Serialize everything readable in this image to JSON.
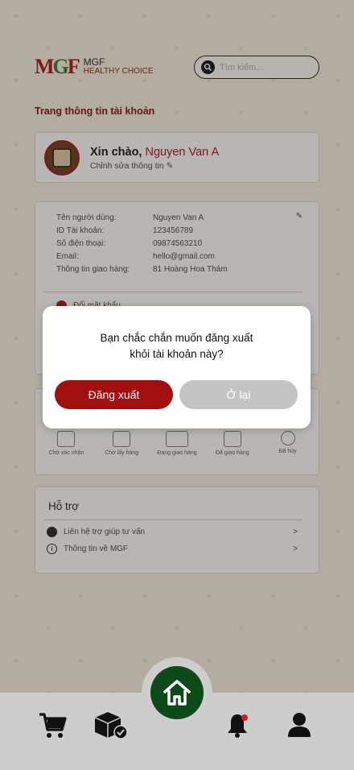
{
  "header": {
    "logo_mark_1": "M",
    "logo_mark_2": "G",
    "logo_mark_3": "F",
    "logo_line1": "MGF",
    "logo_line2": "HEALTHY CHOICE",
    "search_placeholder": "Tìm kiếm..."
  },
  "page_title": "Trang thông tin tài khoản",
  "profile": {
    "greeting": "Xin chào,",
    "name": "Nguyen Van A",
    "edit_label": "Chỉnh sửa thông tin"
  },
  "info": {
    "rows": [
      {
        "key": "Tên người dùng:",
        "value": "Nguyen Van A"
      },
      {
        "key": "ID Tài khoản:",
        "value": "123456789"
      },
      {
        "key": "Số điện thoại:",
        "value": "09874563210"
      },
      {
        "key": "Email:",
        "value": "hello@gmail.com"
      },
      {
        "key": "Thông tin giao hàng:",
        "value": "81 Hoàng Hoa Thám"
      }
    ],
    "change_password": "Đổi mật khẩu"
  },
  "orders": {
    "items": [
      {
        "label": "Chờ xác nhận",
        "icon": "box-open-icon"
      },
      {
        "label": "Chờ lấy hàng",
        "icon": "box-icon"
      },
      {
        "label": "Đang giao hàng",
        "icon": "truck-icon"
      },
      {
        "label": "Đã giao hàng",
        "icon": "box-check-icon"
      },
      {
        "label": "Đã hủy",
        "icon": "cancel-icon"
      }
    ]
  },
  "support": {
    "title": "Hỗ trợ",
    "items": [
      {
        "label": "Liên hệ trợ giúp tư vấn",
        "chevron": ">"
      },
      {
        "label": "Thông tin về MGF",
        "chevron": ">"
      }
    ]
  },
  "dialog": {
    "line1": "Bạn chắc chắn muốn đăng xuất",
    "line2": "khỏi tài khoản này?",
    "confirm_label": "Đăng xuất",
    "cancel_label": "Ở lại"
  },
  "colors": {
    "brand_red": "#a10f0f",
    "brand_green": "#0c4a18",
    "background": "#f3ecd9"
  }
}
